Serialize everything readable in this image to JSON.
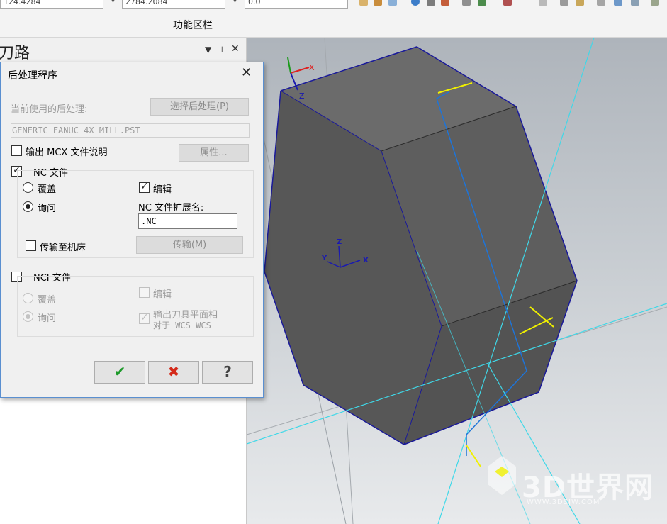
{
  "toolbar": {
    "field1_value": "124.4284",
    "field2_value": "2784.2084",
    "field3_value": "0.0",
    "section_label": "功能区栏"
  },
  "left_panel": {
    "title": "刀路",
    "menu_glyph": "▼",
    "pin_glyph": "ᵖ",
    "close_glyph": "✕"
  },
  "dialog": {
    "title": "后处理程序",
    "close_glyph": "✕",
    "current_post_label": "当前使用的后处理:",
    "select_post_button": "选择后处理(P)",
    "post_path": "GENERIC FANUC 4X MILL.PST",
    "output_mcx_label": "输出 MCX 文件说明",
    "output_mcx_checked": false,
    "properties_button": "属性...",
    "nc_file": {
      "label": "NC 文件",
      "checked": true,
      "overwrite_label": "覆盖",
      "ask_label": "询问",
      "selected": "ask",
      "edit_label": "编辑",
      "edit_checked": true,
      "ext_label": "NC 文件扩展名:",
      "ext_value": ".NC",
      "send_to_machine_label": "传输至机床",
      "send_to_machine_checked": false,
      "transfer_button": "传输(M)"
    },
    "nci_file": {
      "label": "NCI 文件",
      "checked": false,
      "overwrite_label": "覆盖",
      "ask_label": "询问",
      "selected": "ask",
      "edit_label": "编辑",
      "output_plane_line1": "输出刀具平面相",
      "output_plane_line2": "对于 WCS WCS"
    },
    "ok_glyph": "✔",
    "cancel_glyph": "✖",
    "help_glyph": "?"
  },
  "viewport": {
    "axis_labels": {
      "x": "X",
      "y": "Y",
      "z": "Z"
    },
    "view_label": "Z",
    "model_colors": {
      "face_front": "#5a5a5a",
      "face_top": "#666666",
      "face_right": "#4e4e4e",
      "edge": "#1a1aa0",
      "toolpath": "#1e74d8",
      "guide": "#3fd8e8",
      "marker": "#f0f000"
    }
  },
  "watermark": {
    "text": "3D世界网",
    "subtext": "WWW.3DSJW.COM"
  }
}
